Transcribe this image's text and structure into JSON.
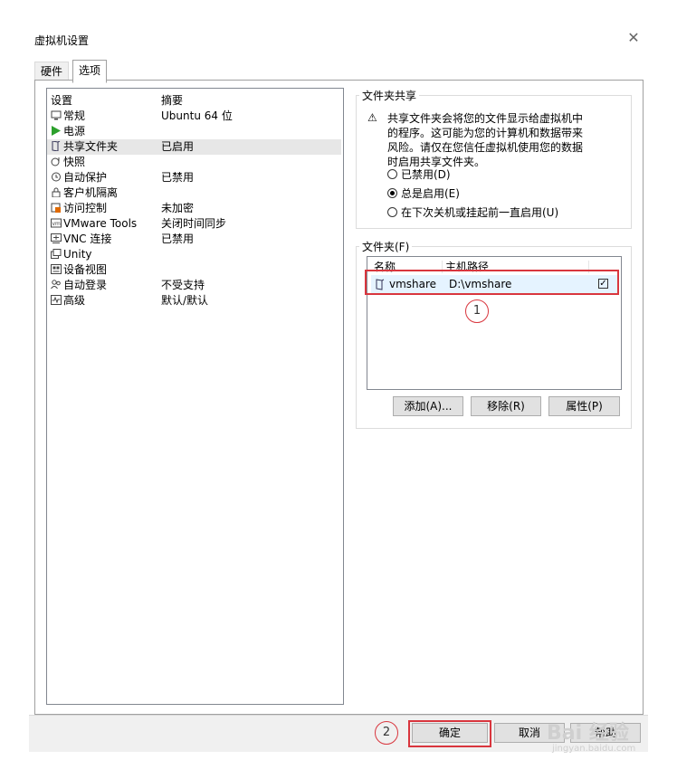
{
  "window": {
    "title": "虚拟机设置"
  },
  "tabs": [
    {
      "label": "硬件"
    },
    {
      "label": "选项"
    }
  ],
  "settings_list": {
    "headers": {
      "setting": "设置",
      "summary": "摘要"
    },
    "items": [
      {
        "label": "常规",
        "summary": "Ubuntu 64 位",
        "icon": "monitor-icon"
      },
      {
        "label": "电源",
        "summary": "",
        "icon": "play-icon"
      },
      {
        "label": "共享文件夹",
        "summary": "已启用",
        "icon": "shared-folder-icon"
      },
      {
        "label": "快照",
        "summary": "",
        "icon": "snapshot-icon"
      },
      {
        "label": "自动保护",
        "summary": "已禁用",
        "icon": "clock-icon"
      },
      {
        "label": "客户机隔离",
        "summary": "",
        "icon": "lock-icon"
      },
      {
        "label": "访问控制",
        "summary": "未加密",
        "icon": "access-control-icon"
      },
      {
        "label": "VMware Tools",
        "summary": "关闭时间同步",
        "icon": "vm-icon"
      },
      {
        "label": "VNC 连接",
        "summary": "已禁用",
        "icon": "vnc-icon"
      },
      {
        "label": "Unity",
        "summary": "",
        "icon": "unity-icon"
      },
      {
        "label": "设备视图",
        "summary": "",
        "icon": "device-view-icon"
      },
      {
        "label": "自动登录",
        "summary": "不受支持",
        "icon": "users-icon"
      },
      {
        "label": "高级",
        "summary": "默认/默认",
        "icon": "advanced-icon"
      }
    ],
    "selected_index": 2
  },
  "folder_sharing": {
    "title": "文件夹共享",
    "warning_lines": [
      "共享文件夹会将您的文件显示给虚拟机中",
      "的程序。这可能为您的计算机和数据带来",
      "风险。请仅在您信任虚拟机使用您的数据",
      "时启用共享文件夹。"
    ],
    "options": [
      {
        "label": "已禁用(D)",
        "checked": false
      },
      {
        "label": "总是启用(E)",
        "checked": true
      },
      {
        "label": "在下次关机或挂起前一直启用(U)",
        "checked": false
      }
    ]
  },
  "folders": {
    "title": "文件夹(F)",
    "headers": {
      "name": "名称",
      "path": "主机路径"
    },
    "rows": [
      {
        "name": "vmshare",
        "path": "D:\\vmshare",
        "enabled": true
      }
    ],
    "buttons": {
      "add": "添加(A)...",
      "remove": "移除(R)",
      "properties": "属性(P)"
    }
  },
  "footer": {
    "ok": "确定",
    "cancel": "取消",
    "help": "帮助"
  },
  "annotations": {
    "marker1": "1",
    "marker2": "2"
  },
  "watermark": {
    "brand": "Bai 经验",
    "url": "jingyan.baidu.com"
  },
  "colors": {
    "highlight": "#d9363e",
    "selected_row": "#e7e7e7",
    "play_green": "#2ca02c"
  }
}
